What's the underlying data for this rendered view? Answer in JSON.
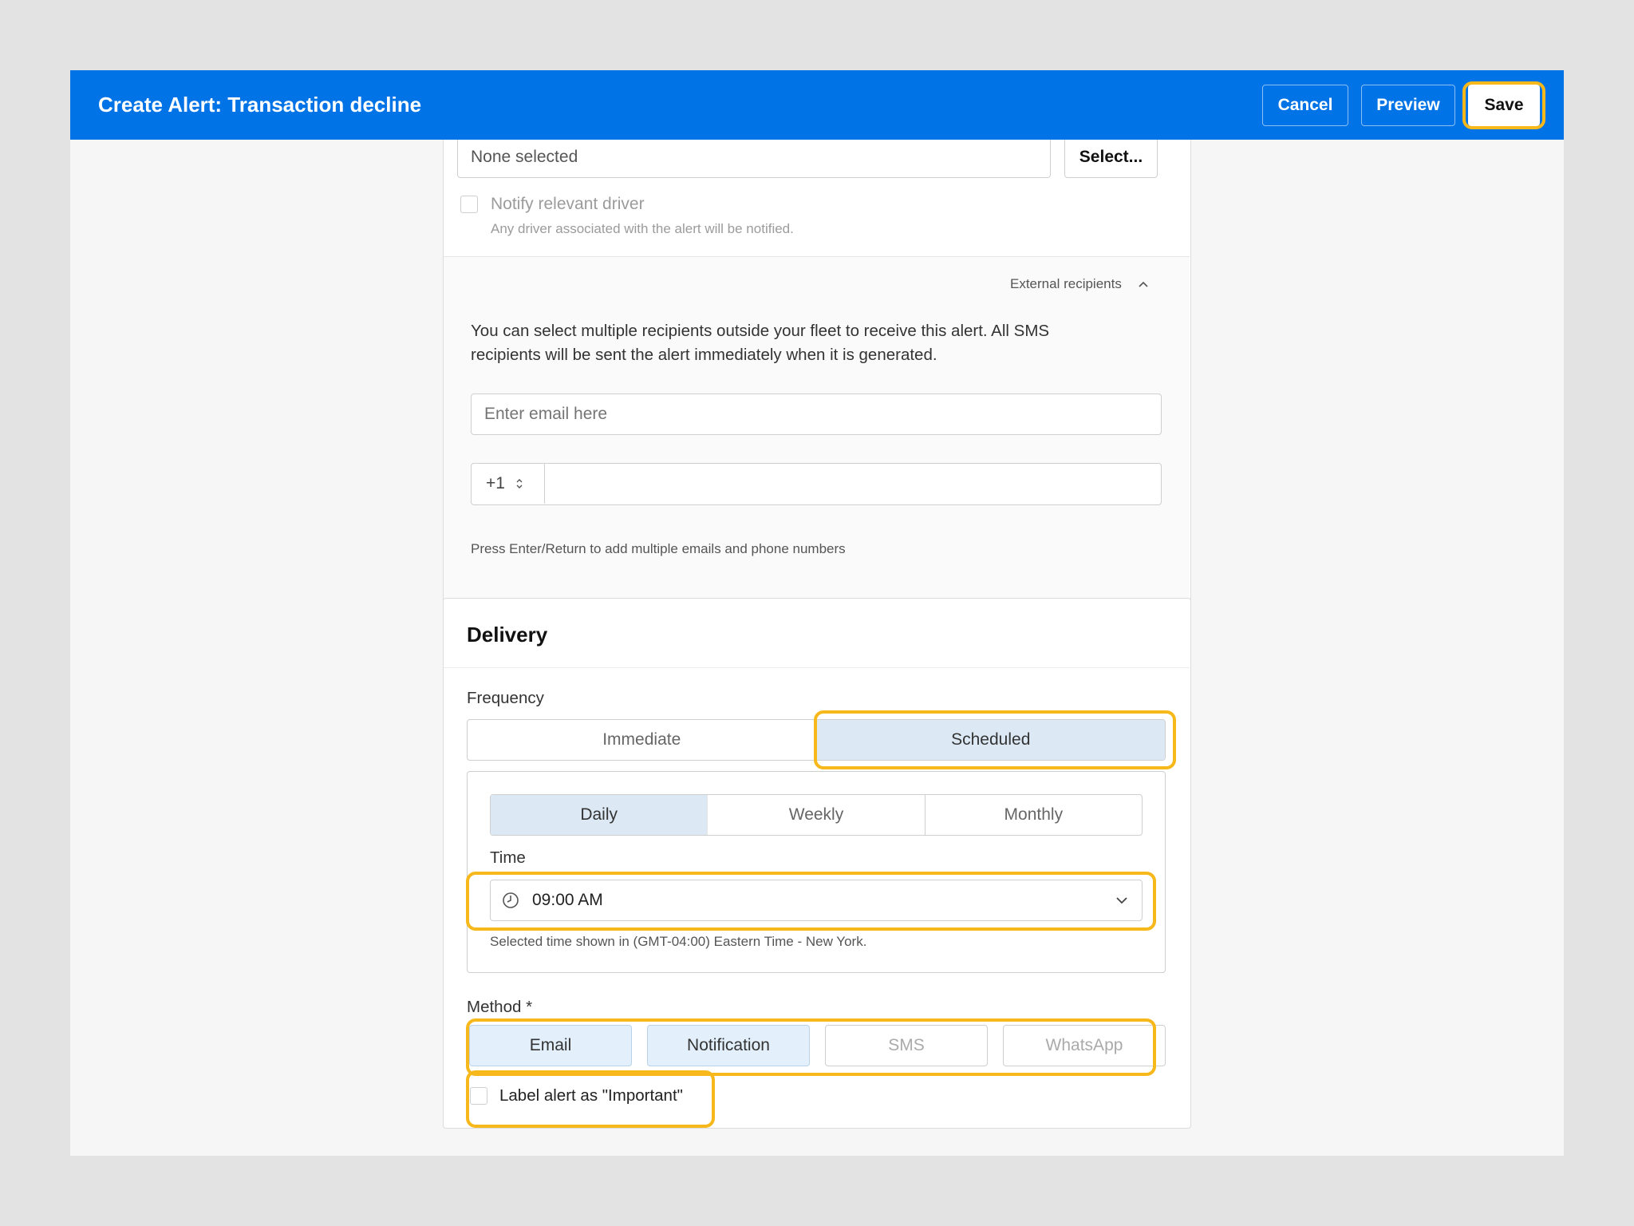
{
  "header": {
    "title": "Create Alert: Transaction decline",
    "cancel": "Cancel",
    "preview": "Preview",
    "save": "Save"
  },
  "recipients": {
    "none_selected": "None selected",
    "select_button": "Select...",
    "notify_driver_label": "Notify relevant driver",
    "notify_driver_hint": "Any driver associated with the alert will be notified.",
    "external_toggle": "External recipients",
    "external_description_line1": "You can select multiple recipients outside your fleet to receive this alert. All SMS",
    "external_description_line2": "recipients will be sent the alert immediately when it is generated.",
    "email_placeholder": "Enter email here",
    "country_code": "+1",
    "phone_value": "",
    "hint": "Press Enter/Return to add multiple emails and phone numbers"
  },
  "delivery": {
    "title": "Delivery",
    "frequency_label": "Frequency",
    "frequency_options": [
      "Immediate",
      "Scheduled"
    ],
    "frequency_selected": "Scheduled",
    "schedule_options": [
      "Daily",
      "Weekly",
      "Monthly"
    ],
    "schedule_selected": "Daily",
    "time_label": "Time",
    "time_value": "09:00 AM",
    "time_hint": "Selected time shown in (GMT-04:00) Eastern Time - New York.",
    "method_label": "Method *",
    "methods": [
      "Email",
      "Notification",
      "SMS",
      "WhatsApp"
    ],
    "methods_selected": [
      "Email",
      "Notification"
    ],
    "important_label": "Label alert as \"Important\""
  },
  "colors": {
    "header_bg": "#0073e6",
    "highlight": "#f7b81b",
    "selected_segment": "#dce9f5"
  }
}
